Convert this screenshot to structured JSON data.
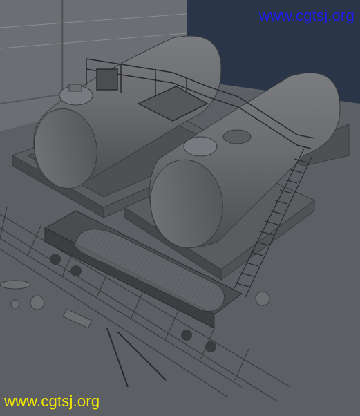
{
  "viewport": {
    "background": "#5f6266",
    "accent_wall": "#2b3548"
  },
  "watermarks": {
    "top": "www.cgtsj.org",
    "bottom": "www.cgtsj.org",
    "top_color": "#1b1bf0",
    "bottom_color": "#f2e600"
  }
}
